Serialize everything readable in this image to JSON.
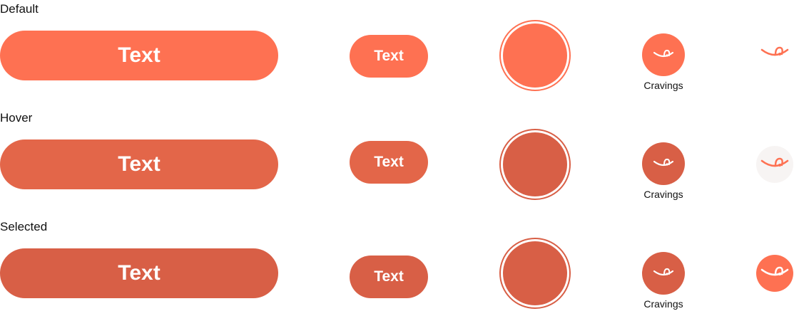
{
  "colors": {
    "default": "#FE7152",
    "hover": "#E36649",
    "selected": "#D85F46",
    "hover_bg_light": "#F7F4F3"
  },
  "icon": "tongue-smile-icon",
  "rows": [
    {
      "state": "Default",
      "large_button": "Text",
      "small_button": "Text",
      "chip_label": "Cravings"
    },
    {
      "state": "Hover",
      "large_button": "Text",
      "small_button": "Text",
      "chip_label": "Cravings"
    },
    {
      "state": "Selected",
      "large_button": "Text",
      "small_button": "Text",
      "chip_label": "Cravings"
    }
  ]
}
